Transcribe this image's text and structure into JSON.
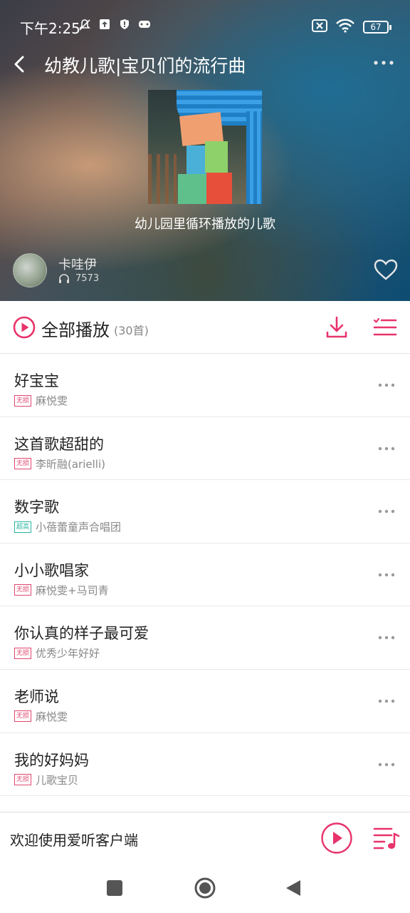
{
  "status_bar": {
    "time": "下午2:25",
    "battery": "67"
  },
  "header": {
    "title": "幼教儿歌|宝贝们的流行曲",
    "description": "幼儿园里循环播放的儿歌",
    "author": "卡哇伊",
    "play_count": "7573"
  },
  "play_all": {
    "label": "全部播放",
    "count": "(30首)"
  },
  "songs": [
    {
      "title": "好宝宝",
      "quality": "无损",
      "artist": "麻悦雯"
    },
    {
      "title": "这首歌超甜的",
      "quality": "无损",
      "artist": "李昕融(arielli)"
    },
    {
      "title": "数字歌",
      "quality": "超高",
      "artist": "小蓓蕾童声合唱团"
    },
    {
      "title": "小小歌唱家",
      "quality": "无损",
      "artist": "麻悦雯+马司青"
    },
    {
      "title": "你认真的样子最可爱",
      "quality": "无损",
      "artist": "优秀少年好好"
    },
    {
      "title": "老师说",
      "quality": "无损",
      "artist": "麻悦雯"
    },
    {
      "title": "我的好妈妈",
      "quality": "无损",
      "artist": "儿歌宝贝"
    }
  ],
  "mini_player": {
    "text": "欢迎使用爱听客户端"
  },
  "colors": {
    "accent": "#e8336b",
    "hq_badge": "#27b5a0"
  }
}
